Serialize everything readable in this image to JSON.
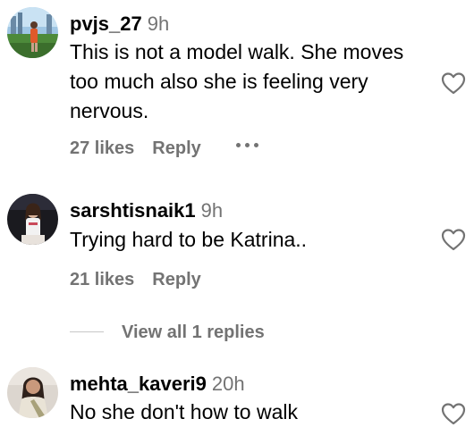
{
  "comments": [
    {
      "username": "pvjs_27",
      "time": "9h",
      "text_lines": [
        "This is not a model walk. She moves",
        "too much also she is feeling very",
        "nervous."
      ],
      "likes": "27 likes",
      "reply_label": "Reply",
      "avatar_icon": "avatar-photo-icon"
    },
    {
      "username": "sarshtisnaik1",
      "time": "9h",
      "text_lines": [
        "Trying hard to be Katrina.."
      ],
      "likes": "21 likes",
      "reply_label": "Reply",
      "avatar_icon": "avatar-photo-icon"
    },
    {
      "username": "mehta_kaveri9",
      "time": "20h",
      "text_lines": [
        "No she don't how to walk"
      ],
      "avatar_icon": "avatar-photo-icon"
    }
  ],
  "view_replies_label": "View all 1 replies",
  "icons": {
    "like": "heart-outline-icon",
    "more": "more-horizontal-icon"
  },
  "colors": {
    "text": "#000000",
    "secondary": "#737373",
    "divider": "#c7c7c7",
    "background": "#ffffff"
  }
}
